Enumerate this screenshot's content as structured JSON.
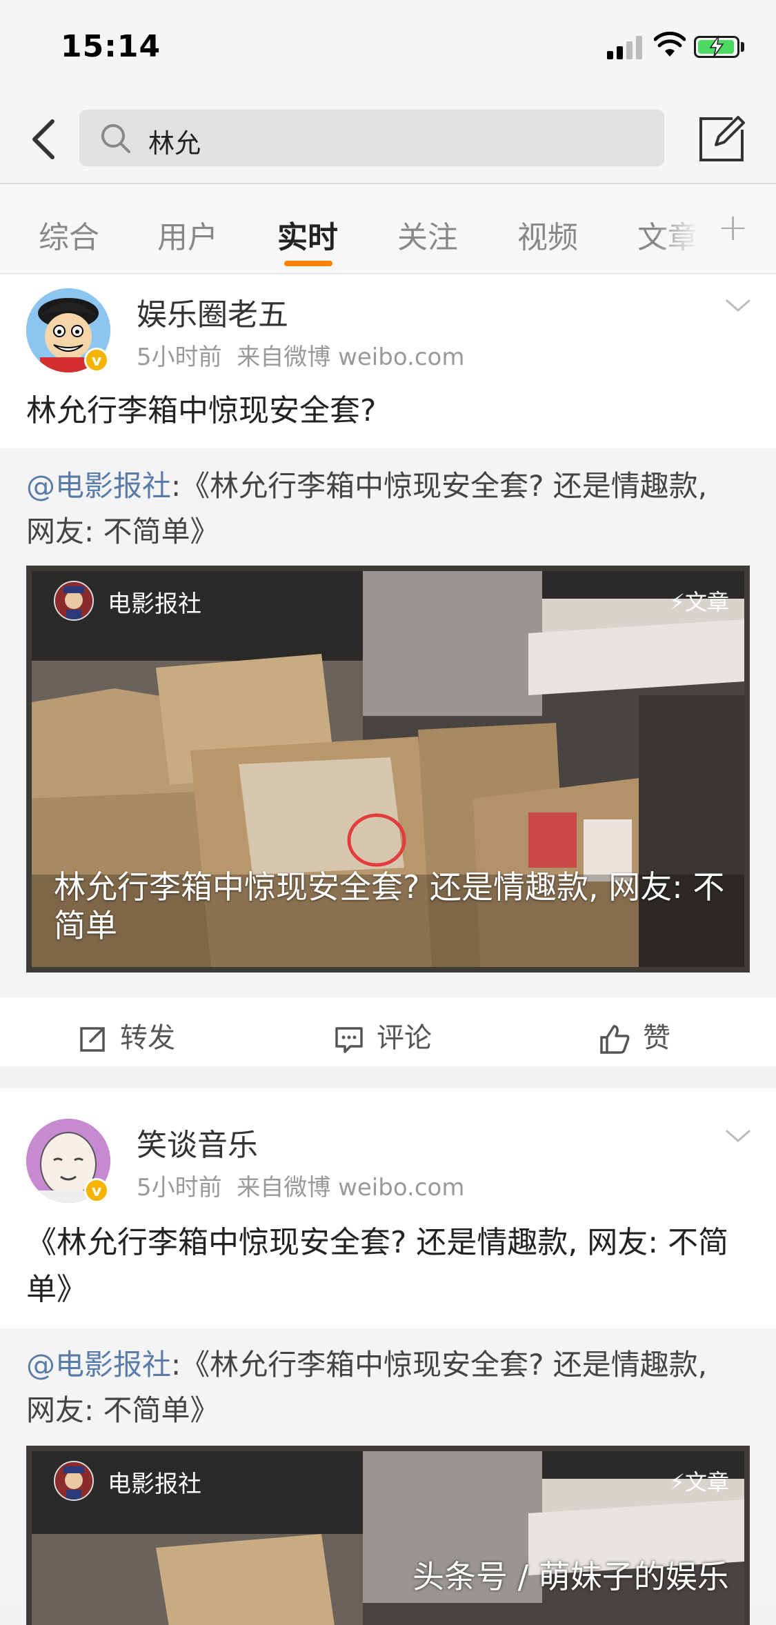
{
  "status": {
    "time": "15:14"
  },
  "nav": {
    "search_query": "林允"
  },
  "tabs": [
    {
      "label": "综合"
    },
    {
      "label": "用户"
    },
    {
      "label": "实时"
    },
    {
      "label": "关注"
    },
    {
      "label": "视频"
    },
    {
      "label": "文章"
    }
  ],
  "active_tab": "实时",
  "posts": [
    {
      "author": "娱乐圈老五",
      "time": "5小时前",
      "source": "来自微博 weibo.com",
      "text": "林允行李箱中惊现安全套?",
      "repost_mention": "@电影报社",
      "repost_text": ":《林允行李箱中惊现安全套? 还是情趣款, 网友: 不简单》",
      "card_source": "电影报社",
      "card_badge": "⚡文章",
      "card_caption": "林允行李箱中惊现安全套? 还是情趣款, 网友: 不简单"
    },
    {
      "author": "笑谈音乐",
      "time": "5小时前",
      "source": "来自微博 weibo.com",
      "text": "《林允行李箱中惊现安全套? 还是情趣款, 网友: 不简单》",
      "repost_mention": "@电影报社",
      "repost_text": ":《林允行李箱中惊现安全套? 还是情趣款, 网友: 不简单》",
      "card_source": "电影报社",
      "card_badge": "⚡文章"
    }
  ],
  "actions": {
    "repost": "转发",
    "comment": "评论",
    "like": "赞"
  },
  "watermark": "头条号 / 萌妹子的娱乐",
  "colors": {
    "accent": "#ff8200",
    "mention": "#5a7ca8",
    "verified": "#f4b400"
  }
}
